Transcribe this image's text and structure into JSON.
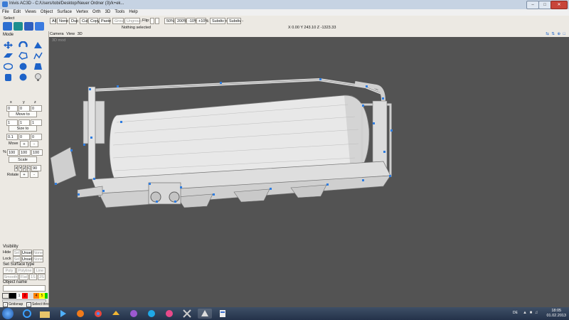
{
  "window": {
    "title": "Inivis AC3D - C:/Users/tobi/Desktop/Neuer Ordner (3)/k+ek..."
  },
  "menu": [
    "File",
    "Edit",
    "Views",
    "Object",
    "Surface",
    "Vertex",
    "Orth",
    "3D",
    "Tools",
    "Help"
  ],
  "toolbar": {
    "buttons": {
      "all": "All",
      "none": "None",
      "dup": "Dup",
      "cut": "Cut",
      "copy": "Copy",
      "paste": "Paste",
      "group": "Group",
      "ungroup": "Ungroup",
      "p50": "50%",
      "p200": "200%",
      "m10": "-10%",
      "p10": "+10%",
      "subdiv_plus": "Subdiv +",
      "subdiv_minus": "Subdiv -"
    },
    "flip_label": "Flip:",
    "status": "Nothing selected",
    "coords": "X 0.00 Y 243.10 Z -1323.33"
  },
  "left": {
    "select_label": "Select",
    "mode_label": "Mode",
    "xyz_labels": [
      "x",
      "y",
      "z"
    ],
    "move_vals": [
      "0",
      "0",
      "0"
    ],
    "move_to": "Move to",
    "size_vals": [
      "1",
      "1",
      "1"
    ],
    "size_to": "Size to",
    "step_vals": [
      "0.1",
      "0",
      "0"
    ],
    "move": "Move",
    "plus": "+",
    "minus": "-",
    "pct": "%",
    "scale_vals": [
      "100",
      "100",
      "100"
    ],
    "scale": "Scale",
    "axis_labels": [
      "X",
      "Y",
      "Z",
      "C"
    ],
    "rotate_val": "90",
    "rotate": "Rotate",
    "visibility": "Visibility",
    "hide": "Hide",
    "lock": "Lock",
    "sel": "Sel",
    "unsel": "Unsel",
    "none": "None",
    "surface_type": "Set Surface type",
    "poly": "Poly",
    "polyline": "Polyline",
    "line": "Line",
    "smooth": "Smooth",
    "flat": "Flat",
    "s1": "1S",
    "s2": "2S",
    "object_name": "Object name",
    "palette_num": "1",
    "palette_colors": [
      "#ffffff",
      "#000000",
      "#ff0000",
      "#ffff00",
      "#00cc00",
      "#ff8000"
    ],
    "palette_nums": [
      "1",
      "2",
      "3",
      "4",
      "5"
    ],
    "gridsnap": "Gridsnap",
    "select_through": "Select through"
  },
  "viewport": {
    "tabs": [
      "Camera",
      "View",
      "3D"
    ],
    "label": "3D mod"
  },
  "taskbar": {
    "lang": "DE",
    "time": "18:05",
    "date": "01.02.2013"
  }
}
